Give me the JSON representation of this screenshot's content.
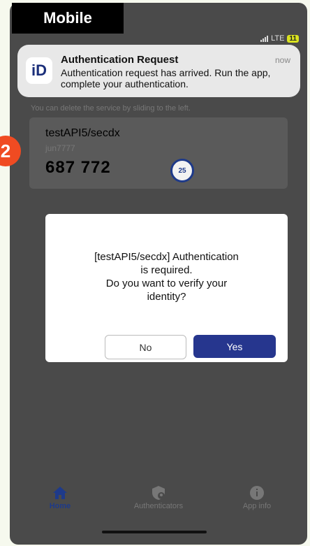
{
  "label_tag": "Mobile",
  "step_number": "2",
  "status_bar": {
    "network": "LTE",
    "battery": "11"
  },
  "notification": {
    "app_logo": "iD",
    "title": "Authentication Request",
    "time": "now",
    "body": "Authentication request has arrived. Run the app, complete your authentication."
  },
  "hint": "You can delete the service by sliding to the left.",
  "service": {
    "name": "testAPI5/secdx",
    "user": "jun7777",
    "code": "687 772",
    "timer": "25"
  },
  "dialog": {
    "message": "[testAPI5/secdx] Authentication\nis required.\nDo you want to verify your\nidentity?",
    "no_label": "No",
    "yes_label": "Yes"
  },
  "nav": {
    "home_label": "Home",
    "authenticators_label": "Authenticators",
    "app_info_label": "App info"
  },
  "colors": {
    "accent": "#26368e",
    "step_badge": "#f04b22"
  }
}
